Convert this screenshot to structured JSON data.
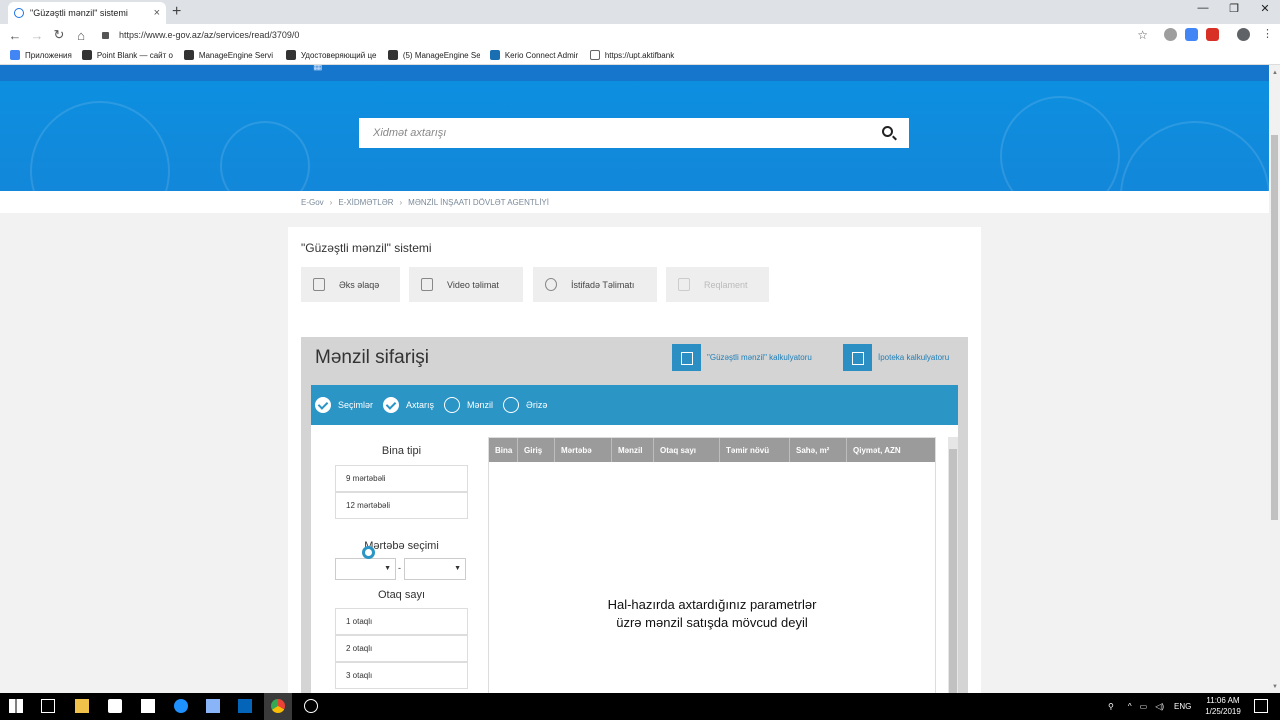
{
  "browser": {
    "tab_title": "\"Güzəştli mənzil\" sistemi",
    "tab_close": "×",
    "new_tab": "+",
    "url": "https://www.e-gov.az/az/services/read/3709/0",
    "window_controls": [
      "—",
      "❐",
      "✕"
    ],
    "bookmarks": [
      {
        "label": "Приложения",
        "color": "#4285f4"
      },
      {
        "label": "Point Blank — сайт о",
        "color": "#333333"
      },
      {
        "label": "ManageEngine Servi",
        "color": "#333333"
      },
      {
        "label": "Удостоверяющий це",
        "color": "#333333"
      },
      {
        "label": "(5) ManageEngine Se",
        "color": "#333333"
      },
      {
        "label": "Kerio Connect Admir",
        "color": "#1a6fb3"
      },
      {
        "label": "https://upt.aktifbank",
        "color": "#666666"
      }
    ]
  },
  "site": {
    "search_placeholder": "Xidmət axtarışı",
    "breadcrumb": [
      "E-Gov",
      "E-XİDMƏTLƏR",
      "MƏNZİL İNŞAATI DÖVLƏT AGENTLİYİ"
    ],
    "breadcrumb_sep": "›",
    "page_title": "\"Güzəştli mənzil\" sistemi",
    "actions": [
      {
        "label": "Əks əlaqə",
        "enabled": true
      },
      {
        "label": "Video təlimat",
        "enabled": true
      },
      {
        "label": "İstifadə Təlimatı",
        "enabled": true
      },
      {
        "label": "Reqlament",
        "enabled": false
      }
    ]
  },
  "order": {
    "title": "Mənzil sifarişi",
    "calc_links": [
      "\"Güzəştli mənzil\" kalkulyatoru",
      "İpoteka kalkulyatoru"
    ],
    "steps": [
      {
        "label": "Seçimlər",
        "done": true
      },
      {
        "label": "Axtarış",
        "done": true
      },
      {
        "label": "Mənzil",
        "done": false
      },
      {
        "label": "Ərizə",
        "done": false
      }
    ],
    "building_type": {
      "title": "Bina tipi",
      "options": [
        "9 mərtəbəli",
        "12 mərtəbəli"
      ]
    },
    "floor": {
      "title": "Mərtəbə seçimi",
      "dash": "-",
      "caret": "▼"
    },
    "rooms": {
      "title": "Otaq sayı",
      "options": [
        "1 otaqlı",
        "2 otaqlı",
        "3 otaqlı"
      ]
    },
    "table": {
      "headers": [
        "Bina",
        "Giriş",
        "Mərtəbə",
        "Mənzil",
        "Otaq sayı",
        "Təmir növü",
        "Sahə, m²",
        "Qiymət, AZN"
      ],
      "empty_line1": "Hal-hazırda axtardığınız parametrlər",
      "empty_line2": "üzrə mənzil satışda mövcud deyil"
    }
  },
  "taskbar": {
    "language": "ENG",
    "time": "11:06 AM",
    "date": "1/25/2019"
  }
}
